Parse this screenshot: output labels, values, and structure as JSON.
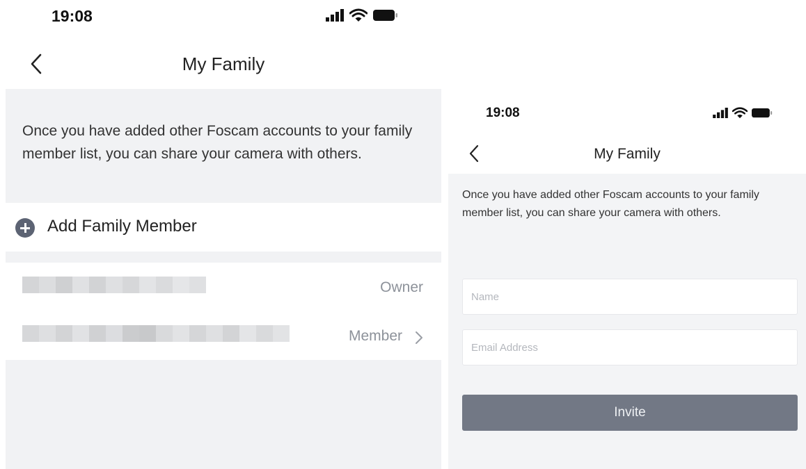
{
  "left_screen": {
    "status_bar": {
      "time": "19:08"
    },
    "nav": {
      "title": "My Family"
    },
    "description": "Once you have added other Foscam accounts to your family member list, you can share your camera with others.",
    "add_member_label": "Add Family Member",
    "members": [
      {
        "role": "Owner"
      },
      {
        "role": "Member"
      }
    ]
  },
  "right_screen": {
    "status_bar": {
      "time": "19:08"
    },
    "nav": {
      "title": "My Family"
    },
    "description": "Once you have added other Foscam accounts to your family member list, you can share your camera with others.",
    "form": {
      "name_placeholder": "Name",
      "email_placeholder": "Email Address",
      "invite_label": "Invite"
    }
  },
  "colors": {
    "background_gray": "#f1f2f4",
    "accent_dark_gray": "#5c6373",
    "button_gray": "#727885",
    "secondary_text": "#8d929a"
  },
  "icons": [
    "signal-icon",
    "wifi-icon",
    "battery-icon",
    "back-chevron-icon",
    "plus-circle-icon",
    "chevron-right-icon"
  ]
}
